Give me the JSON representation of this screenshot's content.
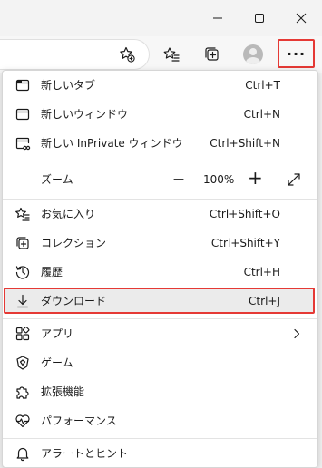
{
  "menu": {
    "items": [
      {
        "label": "新しいタブ",
        "shortcut": "Ctrl+T",
        "icon": "new-tab-icon"
      },
      {
        "label": "新しいウィンドウ",
        "shortcut": "Ctrl+N",
        "icon": "new-window-icon"
      },
      {
        "label": "新しい InPrivate ウィンドウ",
        "shortcut": "Ctrl+Shift+N",
        "icon": "inprivate-icon"
      },
      {
        "label": "お気に入り",
        "shortcut": "Ctrl+Shift+O",
        "icon": "favorites-icon"
      },
      {
        "label": "コレクション",
        "shortcut": "Ctrl+Shift+Y",
        "icon": "collections-icon"
      },
      {
        "label": "履歴",
        "shortcut": "Ctrl+H",
        "icon": "history-icon"
      },
      {
        "label": "ダウンロード",
        "shortcut": "Ctrl+J",
        "icon": "download-icon"
      },
      {
        "label": "アプリ",
        "shortcut": "",
        "icon": "apps-icon"
      },
      {
        "label": "ゲーム",
        "shortcut": "",
        "icon": "games-icon"
      },
      {
        "label": "拡張機能",
        "shortcut": "",
        "icon": "extensions-icon"
      },
      {
        "label": "パフォーマンス",
        "shortcut": "",
        "icon": "performance-icon"
      },
      {
        "label": "アラートとヒント",
        "shortcut": "",
        "icon": "bell-icon"
      }
    ],
    "zoom": {
      "label": "ズーム",
      "minus": "—",
      "value": "100%",
      "plus": "+"
    },
    "highlighted_item": "ダウンロード"
  },
  "toolbar": {
    "more_button": "···"
  },
  "colors": {
    "highlight_border": "#e53935",
    "hover_background": "#ebebeb",
    "menu_background": "#ffffff"
  }
}
